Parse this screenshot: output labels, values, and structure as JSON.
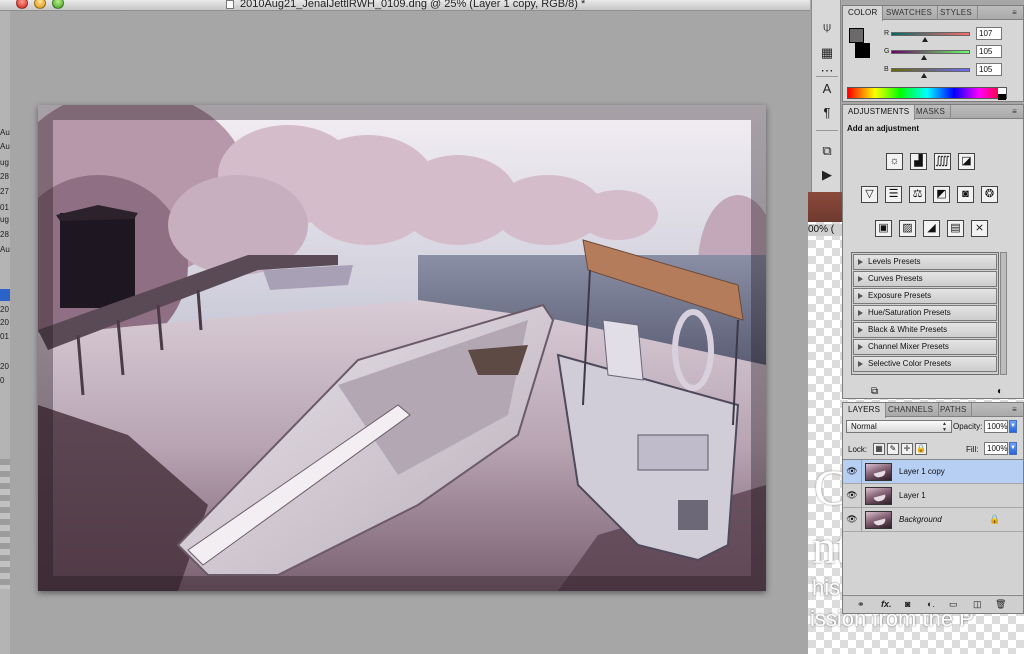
{
  "window": {
    "title": "2010Aug21_JenalJettlRWH_0109.dng @ 25% (Layer 1 copy, RGB/8) *"
  },
  "left_strip": {
    "fragments": [
      "Au",
      "Au",
      "ug",
      "28",
      "27",
      "01",
      "ug",
      "28",
      "Aug",
      "20",
      "20",
      "01",
      "20",
      "0"
    ]
  },
  "tools": [
    {
      "icon": "audio-annotation-icon",
      "glyph": "⍦"
    },
    {
      "icon": "three-d-tool-icon",
      "glyph": "▦"
    },
    {
      "icon": "more-icon",
      "glyph": "⋯"
    },
    {
      "icon": "character-icon",
      "glyph": "A"
    },
    {
      "icon": "paragraph-icon",
      "glyph": "¶"
    },
    {
      "icon": "layer-comps-icon",
      "glyph": "⧉"
    },
    {
      "icon": "actions-icon",
      "glyph": "▶"
    }
  ],
  "color_panel": {
    "tabs": [
      "COLOR",
      "SWATCHES",
      "STYLES"
    ],
    "foreground": "#6b6969",
    "background": "#000000",
    "channels": [
      {
        "label": "R",
        "value": "107"
      },
      {
        "label": "G",
        "value": "105"
      },
      {
        "label": "B",
        "value": "105"
      }
    ]
  },
  "adjustments_panel": {
    "tabs": [
      "ADJUSTMENTS",
      "MASKS"
    ],
    "title": "Add an adjustment",
    "icons_row1": [
      {
        "name": "brightness-contrast-icon",
        "glyph": "☼"
      },
      {
        "name": "levels-icon",
        "glyph": "▟"
      },
      {
        "name": "curves-icon",
        "glyph": "⨌"
      },
      {
        "name": "exposure-icon",
        "glyph": "◪"
      }
    ],
    "icons_row2": [
      {
        "name": "vibrance-icon",
        "glyph": "▽"
      },
      {
        "name": "hue-saturation-icon",
        "glyph": "☰"
      },
      {
        "name": "color-balance-icon",
        "glyph": "⚖"
      },
      {
        "name": "black-white-icon",
        "glyph": "◩"
      },
      {
        "name": "photo-filter-icon",
        "glyph": "◙"
      },
      {
        "name": "channel-mixer-icon",
        "glyph": "❂"
      }
    ],
    "icons_row3": [
      {
        "name": "invert-icon",
        "glyph": "▣"
      },
      {
        "name": "posterize-icon",
        "glyph": "▨"
      },
      {
        "name": "threshold-icon",
        "glyph": "◢"
      },
      {
        "name": "gradient-map-icon",
        "glyph": "▤"
      },
      {
        "name": "selective-color-icon",
        "glyph": "⨯"
      }
    ],
    "presets": [
      "Levels Presets",
      "Curves Presets",
      "Exposure Presets",
      "Hue/Saturation Presets",
      "Black & White Presets",
      "Channel Mixer Presets",
      "Selective Color Presets"
    ]
  },
  "layers_panel": {
    "tabs": [
      "LAYERS",
      "CHANNELS",
      "PATHS"
    ],
    "blend_mode": "Normal",
    "opacity_label": "Opacity:",
    "opacity": "100%",
    "lock_label": "Lock:",
    "fill_label": "Fill:",
    "fill": "100%",
    "layers": [
      {
        "name": "Layer 1 copy",
        "selected": true
      },
      {
        "name": "Layer 1",
        "selected": false
      },
      {
        "name": "Background",
        "selected": false
      }
    ]
  },
  "backdrop": {
    "zoom": "00% (",
    "fragment_1": "C",
    "fragment_2": "nt",
    "fragment_3": "his",
    "fragment_4": "ission from the P"
  }
}
